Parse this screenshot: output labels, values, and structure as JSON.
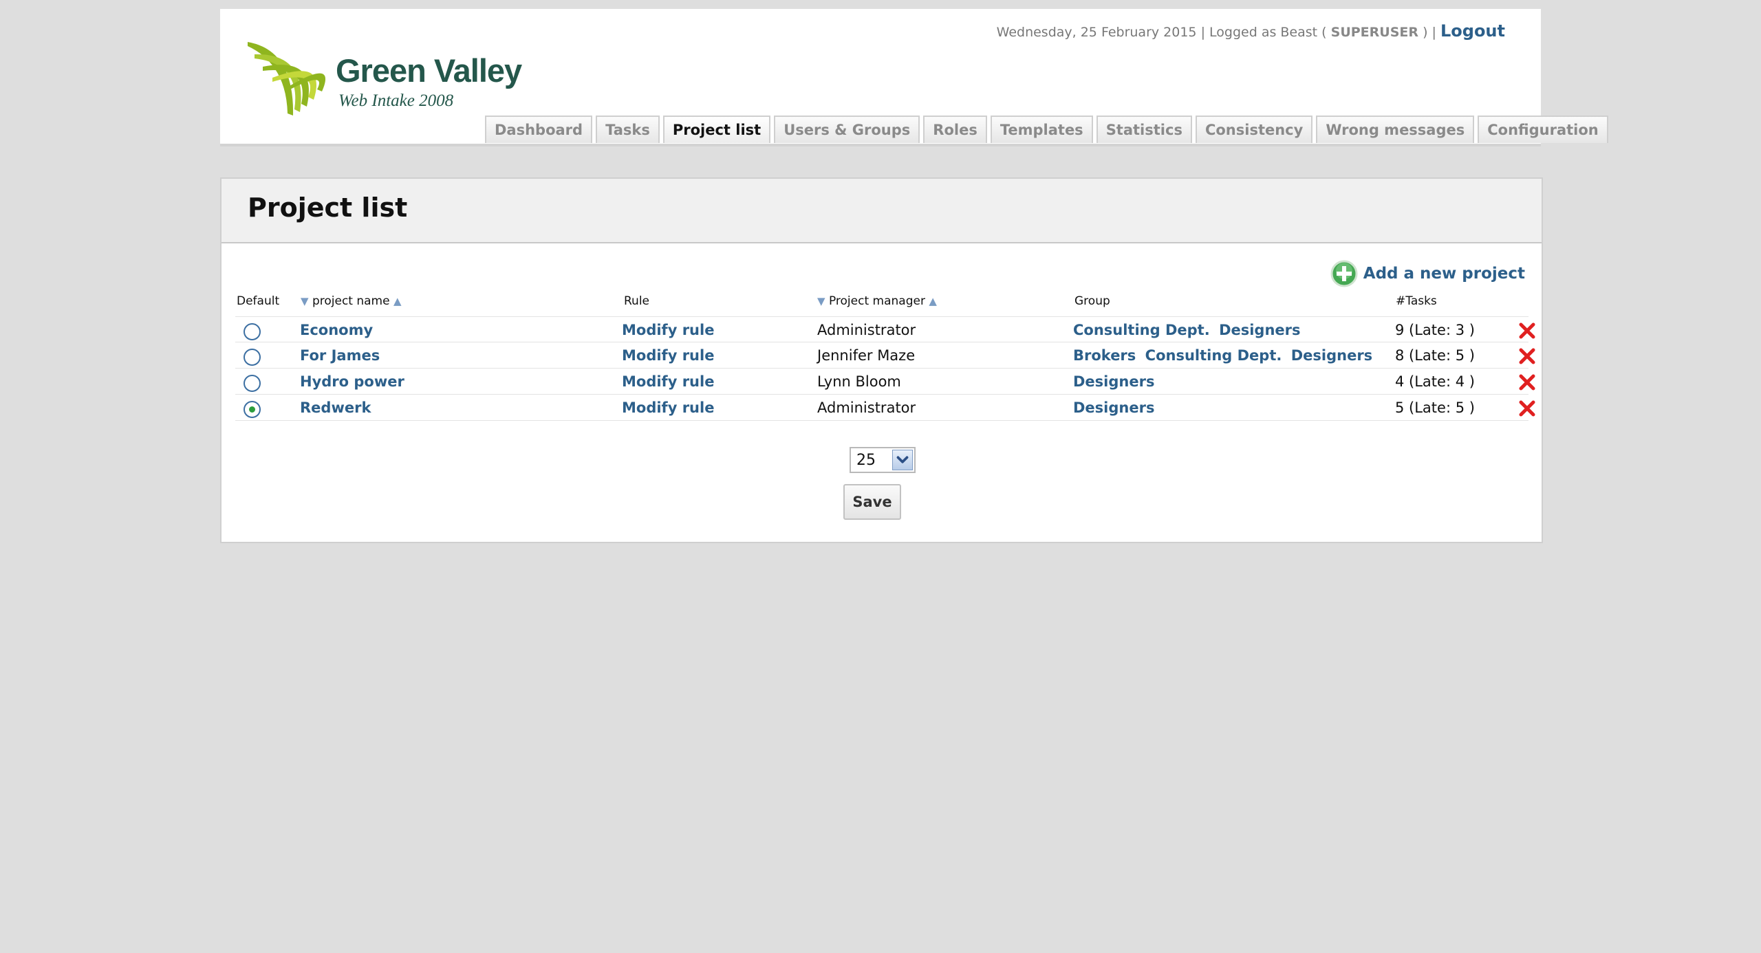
{
  "header": {
    "logo_title": "Green Valley",
    "logo_subtitle": "Web Intake 2008",
    "date_text": "Wednesday, 25 February 2015",
    "separator": "|",
    "logged_as_prefix": "Logged as Beast",
    "role_open": "(",
    "role": "SUPERUSER",
    "role_close": ")",
    "logout_label": "Logout"
  },
  "tabs": [
    {
      "label": "Dashboard",
      "active": false
    },
    {
      "label": "Tasks",
      "active": false
    },
    {
      "label": "Project list",
      "active": true
    },
    {
      "label": "Users & Groups",
      "active": false
    },
    {
      "label": "Roles",
      "active": false
    },
    {
      "label": "Templates",
      "active": false
    },
    {
      "label": "Statistics",
      "active": false
    },
    {
      "label": "Consistency",
      "active": false
    },
    {
      "label": "Wrong messages",
      "active": false
    },
    {
      "label": "Configuration",
      "active": false
    }
  ],
  "page": {
    "title": "Project list",
    "add_project_label": "Add a new project"
  },
  "columns": {
    "default": "Default",
    "project_name": "project name",
    "rule": "Rule",
    "project_manager": "Project manager",
    "group": "Group",
    "tasks": "#Tasks",
    "sort_desc": "▼",
    "sort_asc": "▲"
  },
  "projects": [
    {
      "name": "Economy",
      "rule": "Modify rule",
      "manager": "Administrator",
      "groups": [
        "Consulting Dept.",
        "Designers"
      ],
      "tasks": "9 (Late: 3 )",
      "default": false
    },
    {
      "name": "For James",
      "rule": "Modify rule",
      "manager": "Jennifer Maze",
      "groups": [
        "Brokers",
        "Consulting Dept.",
        "Designers"
      ],
      "tasks": "8 (Late: 5 )",
      "default": false
    },
    {
      "name": "Hydro power",
      "rule": "Modify rule",
      "manager": "Lynn Bloom",
      "groups": [
        "Designers"
      ],
      "tasks": "4 (Late: 4 )",
      "default": false
    },
    {
      "name": "Redwerk",
      "rule": "Modify rule",
      "manager": "Administrator",
      "groups": [
        "Designers"
      ],
      "tasks": "5 (Late: 5 )",
      "default": true
    }
  ],
  "pagination": {
    "page_size": "25"
  },
  "save_label": "Save",
  "colors": {
    "link": "#2c5f8a",
    "logo_green": "#24574b",
    "logo_lime": "#8fb51f",
    "delete_red": "#e02020",
    "background": "#dedede"
  },
  "icons": {
    "add": "plus-circle-icon",
    "delete": "red-x-icon",
    "dropdown": "chevron-down-icon"
  }
}
